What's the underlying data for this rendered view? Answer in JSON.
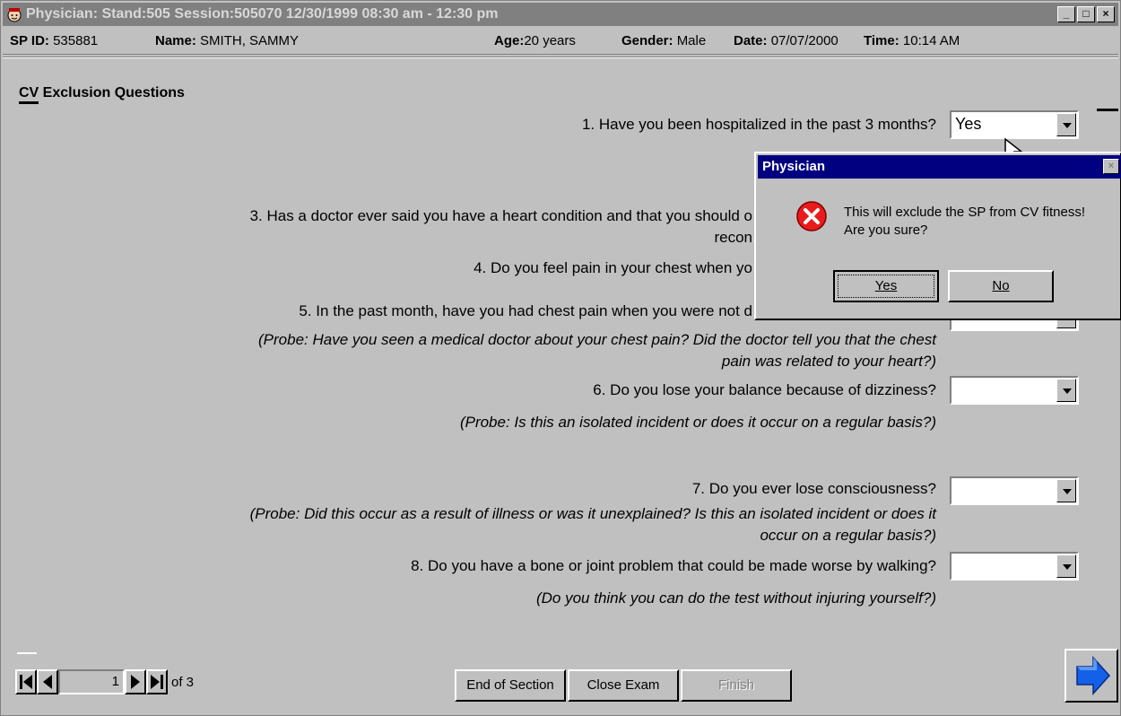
{
  "window": {
    "title": "Physician: Stand:505 Session:505070 12/30/1999 08:30 am - 12:30 pm"
  },
  "header": {
    "sp_id_label": "SP ID:",
    "sp_id": "535881",
    "name_label": "Name:",
    "name": "SMITH, SAMMY",
    "age_label": "Age:",
    "age": "20 years",
    "gender_label": "Gender:",
    "gender": "Male",
    "date_label": "Date:",
    "date": "07/07/2000",
    "time_label": "Time:",
    "time": "10:14 AM"
  },
  "section": {
    "title": "CV Exclusion Questions"
  },
  "questions": {
    "q1": {
      "text": "1. Have you been hospitalized in the past 3 months?",
      "value": "Yes"
    },
    "q3": {
      "line1": "3. Has a doctor ever said you have a heart condition and that you should o",
      "line2": "recon"
    },
    "q4": {
      "text": "4. Do you feel pain in your chest when yo"
    },
    "q5": {
      "text": "5. In the past month, have you had chest pain when you were not d",
      "probe1": "(Probe: Have you seen a medical doctor about your chest pain? Did the doctor tell you that the chest",
      "probe2": "pain was related to your heart?)"
    },
    "q6": {
      "text": "6. Do you lose your balance because of dizziness?",
      "probe": "(Probe: Is this an isolated incident or does it occur on a regular basis?)",
      "value": ""
    },
    "q7": {
      "text": "7. Do you ever lose consciousness?",
      "probe1": "(Probe: Did this occur as a result of illness or was it unexplained? Is this an isolated incident or does it",
      "probe2": "occur on a regular basis?)",
      "value": ""
    },
    "q8": {
      "text": "8. Do you have a bone or joint problem that could be made worse by walking?",
      "probe": "(Do you think you can do the test without injuring yourself?)",
      "value": ""
    }
  },
  "nav": {
    "page": "1",
    "of_label": "of 3",
    "end_of_section": "End of Section",
    "close_exam": "Close Exam",
    "finish": "Finish"
  },
  "dialog": {
    "title": "Physician",
    "line1": "This will exclude the SP from CV fitness!",
    "line2": "Are you sure?",
    "yes": "Yes",
    "no": "No"
  },
  "colors": {
    "face": "#c0c0c0",
    "dialog_title": "#000080",
    "error_icon": "#e81c1c",
    "next_arrow": "#1460e8"
  }
}
